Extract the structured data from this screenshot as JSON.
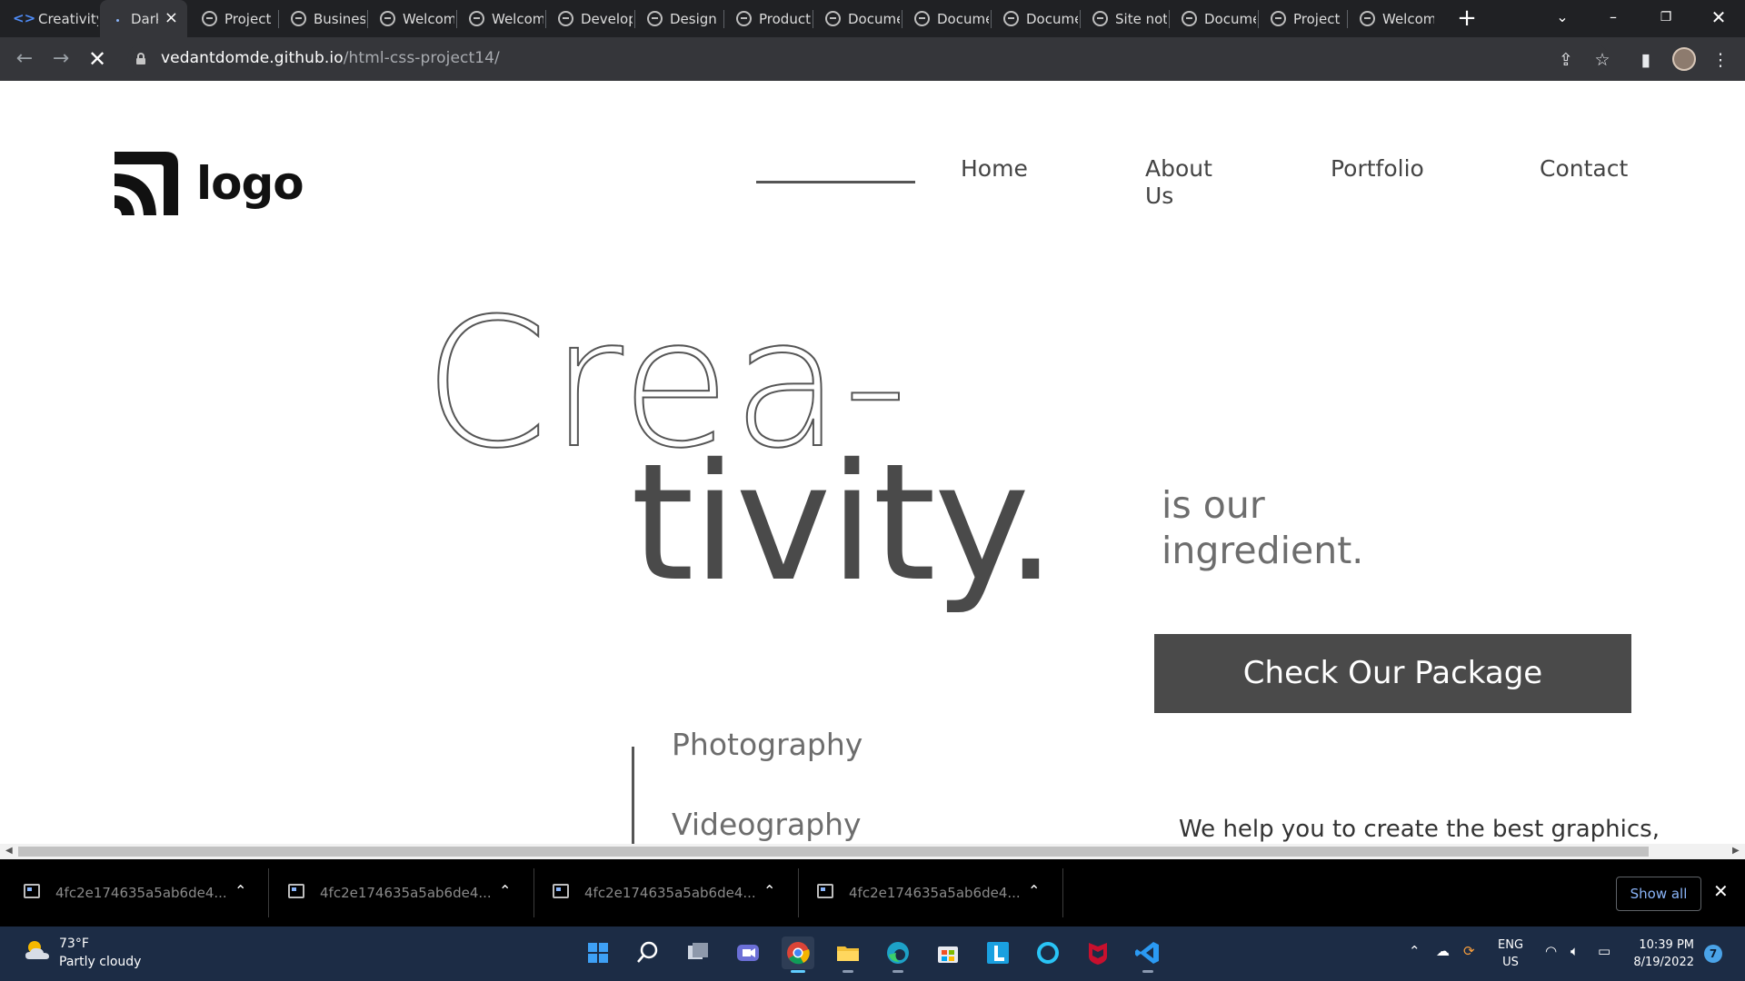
{
  "browser": {
    "tabs": [
      {
        "title": "Creativity",
        "icon": "code-icon",
        "active": false
      },
      {
        "title": "Dark",
        "icon": "loading-icon",
        "active": true
      },
      {
        "title": "Project",
        "icon": "globe-icon",
        "active": false
      },
      {
        "title": "Business",
        "icon": "globe-icon",
        "active": false
      },
      {
        "title": "Welcome",
        "icon": "globe-icon",
        "active": false
      },
      {
        "title": "Welcome",
        "icon": "globe-icon",
        "active": false
      },
      {
        "title": "Developer",
        "icon": "globe-icon",
        "active": false
      },
      {
        "title": "Design",
        "icon": "globe-icon",
        "active": false
      },
      {
        "title": "Product",
        "icon": "globe-icon",
        "active": false
      },
      {
        "title": "Document",
        "icon": "globe-icon",
        "active": false
      },
      {
        "title": "Document",
        "icon": "globe-icon",
        "active": false
      },
      {
        "title": "Document",
        "icon": "globe-icon",
        "active": false
      },
      {
        "title": "Site not",
        "icon": "globe-icon",
        "active": false
      },
      {
        "title": "Document",
        "icon": "globe-icon",
        "active": false
      },
      {
        "title": "Project",
        "icon": "globe-icon",
        "active": false
      },
      {
        "title": "Welcome",
        "icon": "globe-icon",
        "active": false
      }
    ],
    "url_host": "vedantdomde.github.io",
    "url_path": "/html-css-project14/"
  },
  "page": {
    "logo_text": "logo",
    "nav": {
      "home": "Home",
      "about_line1": "About",
      "about_line2": "Us",
      "portfolio": "Portfolio",
      "contact": "Contact"
    },
    "hero": {
      "line1": "Crea-",
      "line2": "tivity.",
      "sub_line1": "is our",
      "sub_line2": "ingredient.",
      "cta": "Check Our Package"
    },
    "services": [
      "Photography",
      "Videography"
    ],
    "tagline": "We help you to create the best graphics,"
  },
  "downloads": {
    "items": [
      "4fc2e174635a5ab6de4...",
      "4fc2e174635a5ab6de4...",
      "4fc2e174635a5ab6de4...",
      "4fc2e174635a5ab6de4..."
    ],
    "show_all": "Show all"
  },
  "taskbar": {
    "weather_temp": "73°F",
    "weather_desc": "Partly cloudy",
    "lang_line1": "ENG",
    "lang_line2": "US",
    "time": "10:39 PM",
    "date": "8/19/2022",
    "notifications": "7",
    "apps": [
      "start-icon",
      "search-icon",
      "task-view-icon",
      "teams-chat-icon",
      "chrome-icon",
      "file-explorer-icon",
      "edge-icon",
      "store-icon",
      "l-app-icon",
      "cortana-icon",
      "mcafee-icon",
      "vscode-icon"
    ]
  },
  "colors": {
    "page_bg": "#ffffff",
    "hero_dark": "#4a4a4a",
    "cta_bg": "#4a4a4a",
    "chrome_dark": "#202124",
    "taskbar_bg": "#1c2c45"
  }
}
